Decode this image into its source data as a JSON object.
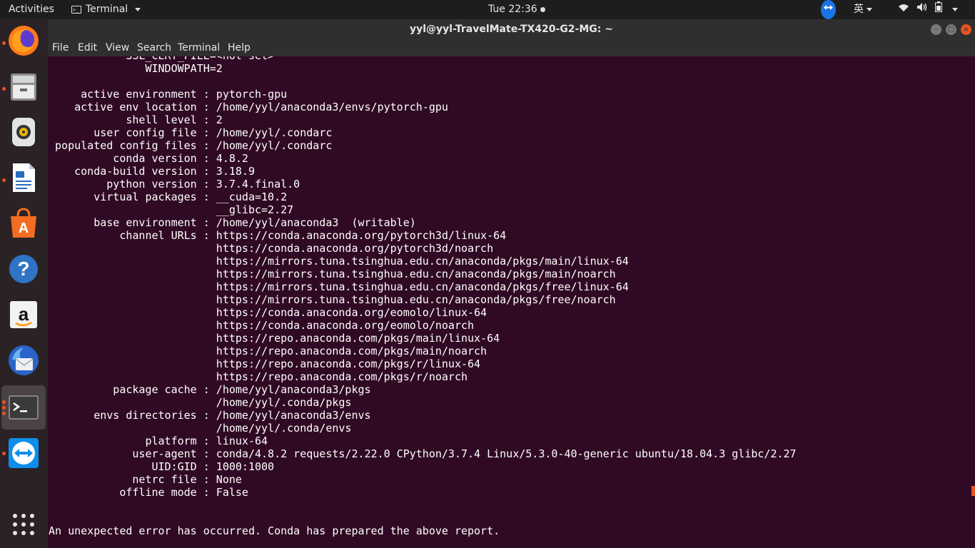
{
  "topbar": {
    "activities": "Activities",
    "app_name": "Terminal",
    "clock": "Tue 22:36",
    "ime": "英"
  },
  "dock": {
    "items": [
      "firefox-icon",
      "files-icon",
      "rhythmbox-icon",
      "writer-icon",
      "software-icon",
      "help-icon",
      "amazon-icon",
      "thunderbird-icon",
      "terminal-icon",
      "teamviewer-icon",
      "show-apps-icon"
    ]
  },
  "window": {
    "title": "yyl@yyl-TravelMate-TX420-G2-MG: ~"
  },
  "menubar": {
    "file": "File",
    "edit": "Edit",
    "view": "View",
    "search": "Search",
    "terminal": "Terminal",
    "help": "Help"
  },
  "terminal": {
    "output": "            SSL_CERT_FILE=<not set>\n               WINDOWPATH=2\n\n     active environment : pytorch-gpu\n    active env location : /home/yyl/anaconda3/envs/pytorch-gpu\n            shell level : 2\n       user config file : /home/yyl/.condarc\n populated config files : /home/yyl/.condarc\n          conda version : 4.8.2\n    conda-build version : 3.18.9\n         python version : 3.7.4.final.0\n       virtual packages : __cuda=10.2\n                          __glibc=2.27\n       base environment : /home/yyl/anaconda3  (writable)\n           channel URLs : https://conda.anaconda.org/pytorch3d/linux-64\n                          https://conda.anaconda.org/pytorch3d/noarch\n                          https://mirrors.tuna.tsinghua.edu.cn/anaconda/pkgs/main/linux-64\n                          https://mirrors.tuna.tsinghua.edu.cn/anaconda/pkgs/main/noarch\n                          https://mirrors.tuna.tsinghua.edu.cn/anaconda/pkgs/free/linux-64\n                          https://mirrors.tuna.tsinghua.edu.cn/anaconda/pkgs/free/noarch\n                          https://conda.anaconda.org/eomolo/linux-64\n                          https://conda.anaconda.org/eomolo/noarch\n                          https://repo.anaconda.com/pkgs/main/linux-64\n                          https://repo.anaconda.com/pkgs/main/noarch\n                          https://repo.anaconda.com/pkgs/r/linux-64\n                          https://repo.anaconda.com/pkgs/r/noarch\n          package cache : /home/yyl/anaconda3/pkgs\n                          /home/yyl/.conda/pkgs\n       envs directories : /home/yyl/anaconda3/envs\n                          /home/yyl/.conda/envs\n               platform : linux-64\n             user-agent : conda/4.8.2 requests/2.22.0 CPython/3.7.4 Linux/5.3.0-40-generic ubuntu/18.04.3 glibc/2.27\n                UID:GID : 1000:1000\n             netrc file : None\n           offline mode : False\n\n\nAn unexpected error has occurred. Conda has prepared the above report."
  }
}
